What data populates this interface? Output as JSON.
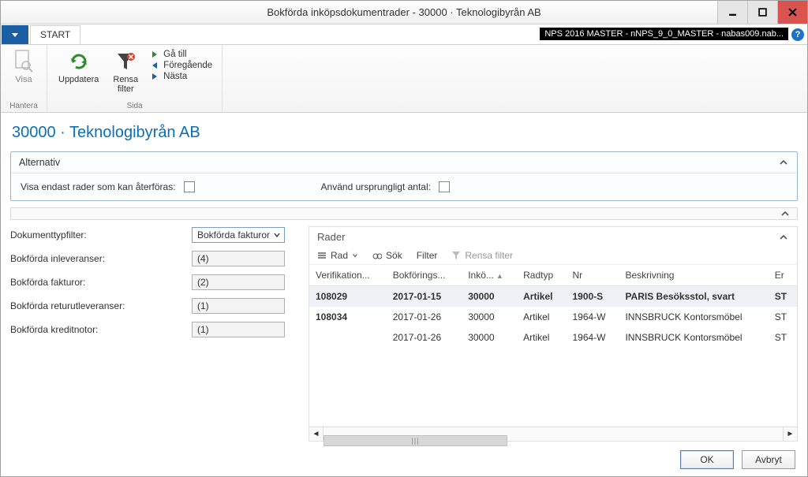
{
  "window": {
    "title": "Bokförda inköpsdokumentrader - 30000 · Teknologibyrån AB"
  },
  "tabs": {
    "file_arrow": "▼",
    "start": "START"
  },
  "db_info": "NPS 2016 MASTER - nNPS_9_0_MASTER - nabas009.nab...",
  "ribbon": {
    "hantera": {
      "label": "Hantera",
      "visa": "Visa"
    },
    "sida": {
      "label": "Sida",
      "uppdatera": "Uppdatera",
      "rensa_filter": "Rensa\nfilter",
      "ga_till": "Gå till",
      "foregaende": "Föregående",
      "nasta": "Nästa"
    }
  },
  "page_heading": "30000 · Teknologibyrån AB",
  "alternativ": {
    "title": "Alternativ",
    "visa_endast": "Visa endast rader som kan återföras:",
    "anvand_ursprungligt": "Använd ursprungligt antal:"
  },
  "filters": {
    "dokumenttyp_label": "Dokumenttypfilter:",
    "dokumenttyp_value": "Bokförda fakturor",
    "rows": [
      {
        "label": "Bokförda inleveranser:",
        "value": "(4)"
      },
      {
        "label": "Bokförda fakturor:",
        "value": "(2)"
      },
      {
        "label": "Bokförda returutleveranser:",
        "value": "(1)"
      },
      {
        "label": "Bokförda kreditnotor:",
        "value": "(1)"
      }
    ]
  },
  "rader": {
    "title": "Rader",
    "toolbar": {
      "rad": "Rad",
      "sok": "Sök",
      "filter": "Filter",
      "rensa": "Rensa filter"
    },
    "columns": {
      "verifikation": "Verifikation...",
      "bokforings": "Bokförings...",
      "inkop": "Inkö...",
      "radtyp": "Radtyp",
      "nr": "Nr",
      "beskrivning": "Beskrivning",
      "er": "Er"
    },
    "rows": [
      {
        "verifikation": "108029",
        "bokforings": "2017-01-15",
        "inkop": "30000",
        "radtyp": "Artikel",
        "nr": "1900-S",
        "beskrivning": "PARIS Besöksstol, svart",
        "er": "ST",
        "bold": true,
        "selected": true
      },
      {
        "verifikation": "108034",
        "bokforings": "2017-01-26",
        "inkop": "30000",
        "radtyp": "Artikel",
        "nr": "1964-W",
        "beskrivning": "INNSBRUCK Kontorsmöbel",
        "er": "ST",
        "bold": true,
        "selected": false
      },
      {
        "verifikation": "",
        "bokforings": "2017-01-26",
        "inkop": "30000",
        "radtyp": "Artikel",
        "nr": "1964-W",
        "beskrivning": "INNSBRUCK Kontorsmöbel",
        "er": "ST",
        "bold": false,
        "selected": false
      }
    ]
  },
  "footer": {
    "ok": "OK",
    "avbryt": "Avbryt"
  }
}
